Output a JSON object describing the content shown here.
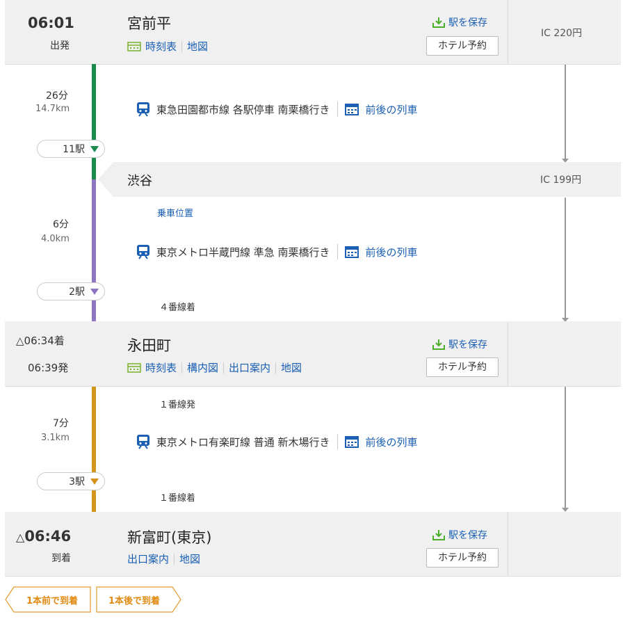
{
  "stations": [
    {
      "name": "宮前平",
      "time": "06:01",
      "time_label": "出発",
      "links": [
        "時刻表",
        "地図"
      ],
      "save": "駅を保存",
      "hotel": "ホテル予約",
      "fare": "IC 220円"
    },
    {
      "name": "渋谷",
      "fare": "IC 199円"
    },
    {
      "name": "永田町",
      "arrive": "△06:34着",
      "depart": "06:39発",
      "links": [
        "時刻表",
        "構内図",
        "出口案内",
        "地図"
      ],
      "save": "駅を保存",
      "hotel": "ホテル予約"
    },
    {
      "name": "新富町(東京)",
      "time_prefix": "△",
      "time": "06:46",
      "time_label": "到着",
      "links": [
        "出口案内",
        "地図"
      ],
      "save": "駅を保存",
      "hotel": "ホテル予約"
    }
  ],
  "segments": [
    {
      "duration": "26分",
      "distance": "14.7km",
      "stops": "11駅",
      "line": "東急田園都市線 各駅停車 南栗橋行き",
      "timetable": "前後の列車",
      "color": "#1a8a4a"
    },
    {
      "duration": "6分",
      "distance": "4.0km",
      "stops": "2駅",
      "boarding": "乗車位置",
      "line": "東京メトロ半蔵門線 準急 南栗橋行き",
      "timetable": "前後の列車",
      "arrive_track": "４番線着",
      "color": "#8f76c1"
    },
    {
      "duration": "7分",
      "distance": "3.1km",
      "stops": "3駅",
      "depart_track": "１番線発",
      "line": "東京メトロ有楽町線 普通 新木場行き",
      "timetable": "前後の列車",
      "arrive_track": "１番線着",
      "color": "#d4961a"
    }
  ],
  "footer": {
    "prev": "1本前で到着",
    "next": "1本後で到着"
  },
  "colors": {
    "link": "#1a5fb4",
    "accent": "#e08a10",
    "save_icon": "#4caf2a"
  }
}
